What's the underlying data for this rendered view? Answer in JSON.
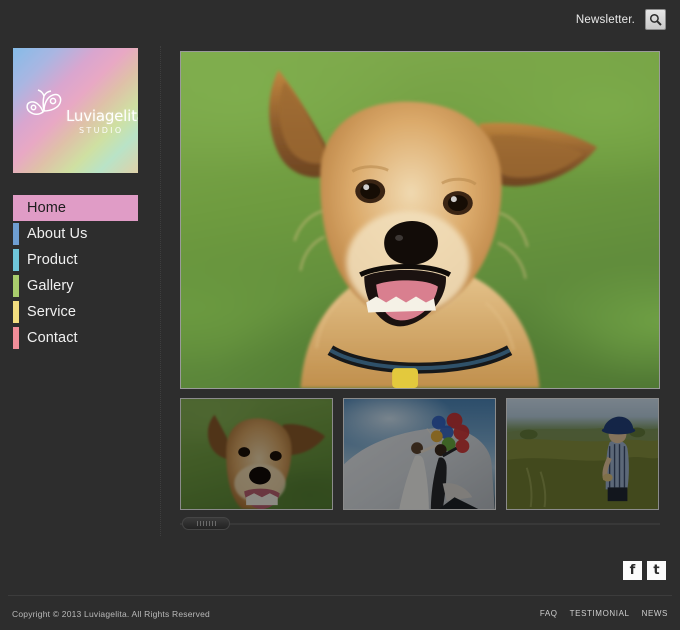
{
  "header": {
    "newsletter_label": "Newsletter.",
    "search_icon": "search-icon"
  },
  "sidebar": {
    "logo": {
      "wordmark": "Luviagelita",
      "sub": "STUDIO",
      "icon": "butterfly-icon"
    },
    "nav_items": [
      {
        "label": "Home",
        "color": "#e09cc6",
        "active": true
      },
      {
        "label": "About Us",
        "color": "#6e9ed2",
        "active": false
      },
      {
        "label": "Product",
        "color": "#6fc6da",
        "active": false
      },
      {
        "label": "Gallery",
        "color": "#a9cd6d",
        "active": false
      },
      {
        "label": "Service",
        "color": "#f2dd7f",
        "active": false
      },
      {
        "label": "Contact",
        "color": "#f08d99",
        "active": false
      }
    ]
  },
  "main": {
    "hero": {
      "caption": "Smiling tan terrier dog on blurred green grass"
    },
    "thumbnails": [
      {
        "caption": "Tan dog face in green grass"
      },
      {
        "caption": "Couple with colorful balloons on a white dune under blue sky"
      },
      {
        "caption": "Child in blue hat standing in a golden field"
      }
    ],
    "slider": {
      "handle_label": "gallery-slider-handle"
    }
  },
  "social": [
    {
      "label": "f",
      "name": "facebook-icon"
    },
    {
      "label": "t",
      "name": "twitter-icon"
    }
  ],
  "footer": {
    "copyright": "Copyright © 2013 Luviagelita. All Rights Reserved",
    "links": [
      "FAQ",
      "TESTIMONIAL",
      "NEWS"
    ]
  },
  "colors": {
    "page_background": "#2d2d2d",
    "accent_active": "#e09cc6",
    "text_primary": "#f0f0f0",
    "text_muted": "#b9b9b9"
  }
}
